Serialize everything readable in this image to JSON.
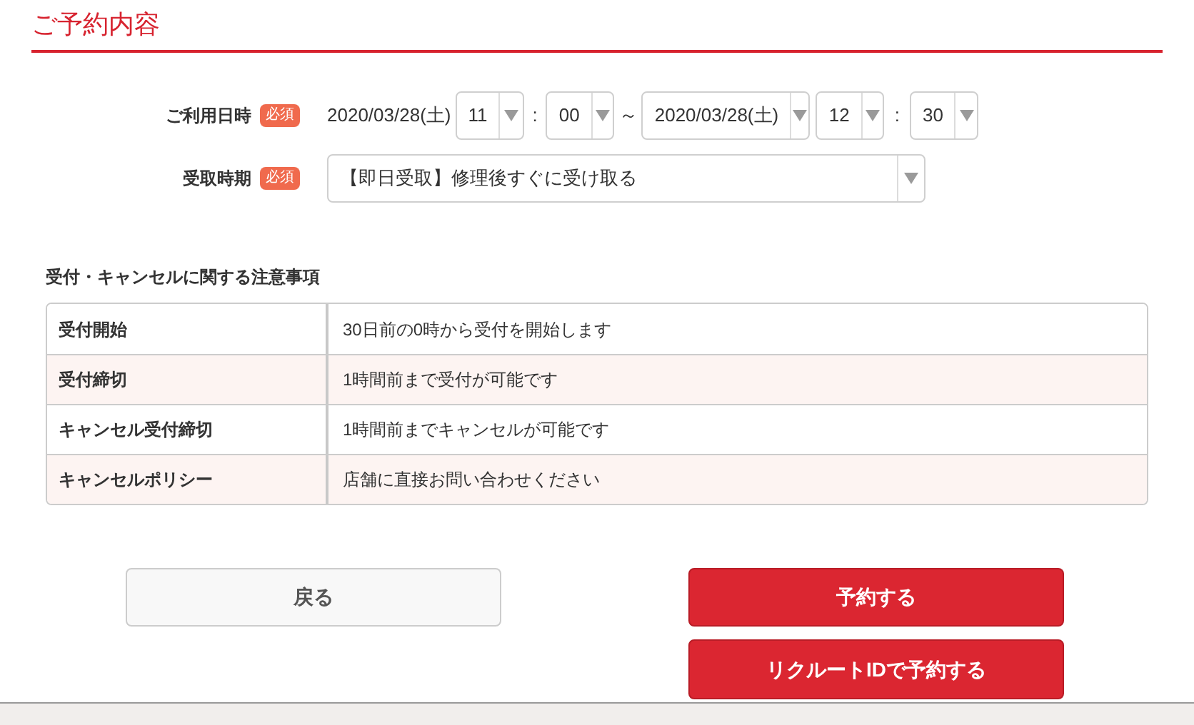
{
  "title": "ご予約内容",
  "form": {
    "datetime": {
      "label": "ご利用日時",
      "badge": "必須",
      "start_date": "2020/03/28(土)",
      "start_hour": "11",
      "start_sep": ":",
      "start_minute": "00",
      "range_sep": "～",
      "end_date": "2020/03/28(土)",
      "end_hour": "12",
      "end_sep": ":",
      "end_minute": "30"
    },
    "pickup": {
      "label": "受取時期",
      "badge": "必須",
      "value": "【即日受取】修理後すぐに受け取る"
    }
  },
  "notes": {
    "heading": "受付・キャンセルに関する注意事項",
    "rows": [
      {
        "label": "受付開始",
        "value": "30日前の0時から受付を開始します"
      },
      {
        "label": "受付締切",
        "value": "1時間前まで受付が可能です"
      },
      {
        "label": "キャンセル受付締切",
        "value": "1時間前までキャンセルが可能です"
      },
      {
        "label": "キャンセルポリシー",
        "value": "店舗に直接お問い合わせください"
      }
    ]
  },
  "buttons": {
    "back": "戻る",
    "reserve": "予約する",
    "reserve_recruit": "リクルートIDで予約する"
  }
}
